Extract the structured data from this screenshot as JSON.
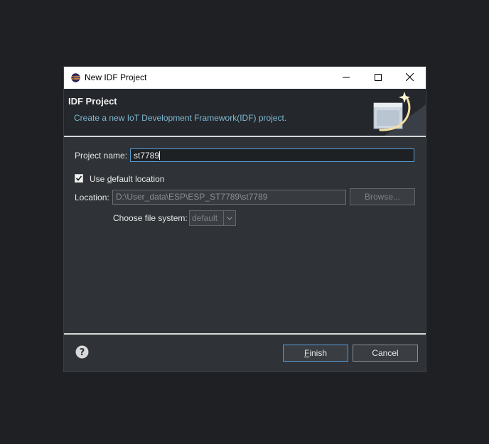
{
  "window": {
    "title": "New IDF Project",
    "app_icon": "eclipse-icon",
    "controls": [
      "minimize-icon",
      "maximize-icon",
      "close-icon"
    ]
  },
  "banner": {
    "heading": "IDF Project",
    "description": "Create a new IoT Development Framework(IDF) project.",
    "graphic": "wizard-graphic"
  },
  "form": {
    "project_name_label": "Project name:",
    "project_name_value": "st7789",
    "use_default_location": {
      "checked": true,
      "label_before": "Use ",
      "label_mnemonic": "d",
      "label_after": "efault location"
    },
    "location_label": "Location:",
    "location_value": "D:\\User_data\\ESP\\ESP_ST7789\\st7789",
    "browse_label": "Browse...",
    "file_system_label": "Choose file system:",
    "file_system_value": "default"
  },
  "footer": {
    "help_icon": "help-icon",
    "finish_mnemonic": "F",
    "finish_rest": "inish",
    "cancel_label": "Cancel"
  },
  "colors": {
    "background": "#1e2023",
    "dialog": "#2f3337",
    "banner": "#24272b",
    "accent": "#5b9bd5",
    "description": "#7fb8d4"
  }
}
